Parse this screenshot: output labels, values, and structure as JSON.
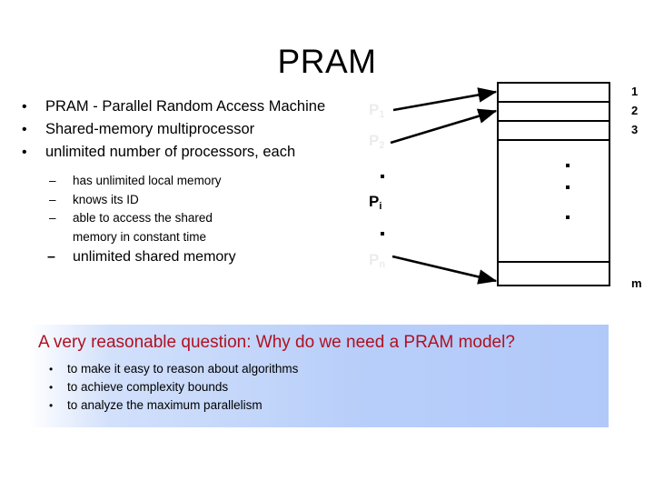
{
  "slide": {
    "title": "PRAM"
  },
  "content": {
    "bullets": [
      {
        "level": 1,
        "marker": "•",
        "text": "PRAM - Parallel Random Access Machine"
      },
      {
        "level": 1,
        "marker": "•",
        "text": "Shared-memory multiprocessor"
      },
      {
        "level": 1,
        "marker": "•",
        "text": "unlimited number of processors, each"
      },
      {
        "level": 2,
        "marker": "–",
        "text": "has unlimited local memory"
      },
      {
        "level": 2,
        "marker": "–",
        "text": "knows its ID"
      },
      {
        "level": 2,
        "marker": "–",
        "text": "able to access the shared"
      },
      {
        "level": 2,
        "marker": "",
        "text": "memory in constant time"
      },
      {
        "level": 2,
        "marker": "–",
        "text": "unlimited shared memory",
        "emphasis": true
      }
    ]
  },
  "diagram": {
    "processors": [
      {
        "label": "P",
        "subscript": "1",
        "shade": "faint"
      },
      {
        "label": "P",
        "subscript": "2",
        "shade": "faint"
      },
      {
        "label": "P",
        "subscript": "i",
        "shade": "dark"
      },
      {
        "label": "P",
        "subscript": "n",
        "shade": "faint"
      }
    ],
    "processor_ellipsis": "·",
    "memory": {
      "row_labels": [
        "1",
        "2",
        "3"
      ],
      "last_row_label": "m",
      "ellipsis": "·"
    },
    "arrow_count": 3
  },
  "callout": {
    "heading": "A very reasonable question: Why do we need a PRAM model?",
    "heading_color": "#b01122",
    "background_start": "#ffffff",
    "background_end": "#b1c9f9",
    "items": [
      {
        "marker": "•",
        "text": "to make it easy to reason about algorithms"
      },
      {
        "marker": "•",
        "text": "to achieve complexity bounds"
      },
      {
        "marker": "•",
        "text": "to analyze the maximum parallelism"
      }
    ]
  }
}
